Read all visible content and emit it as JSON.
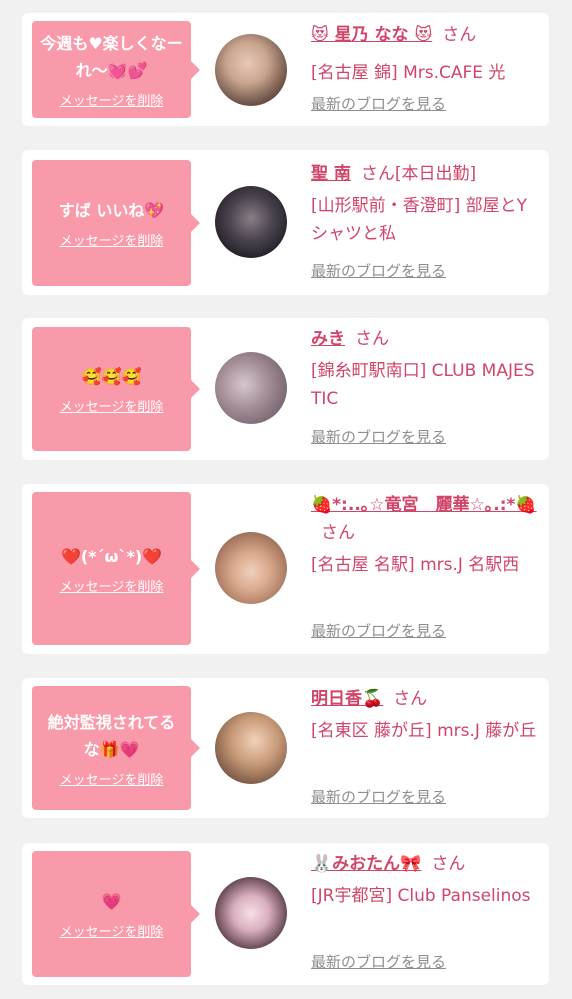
{
  "delete_label": "メッセージを削除",
  "blog_label": "最新のブログを見る",
  "san_label": "さん",
  "colors": {
    "background": "#f1f1f1",
    "bubble": "#f99aab",
    "accent": "#d04569",
    "link_gray": "#8e8e8e"
  },
  "items": [
    {
      "message": "今週も♥楽しくなーれ〜💓💕",
      "name": "😻 星乃 なな 😻",
      "name_suffix": "",
      "shop": "[名古屋 錦] Mrs.CAFE 光"
    },
    {
      "message": "すば いいね💖",
      "name": "聖 南",
      "name_suffix": "[本日出勤]",
      "shop": "[山形駅前・香澄町] 部屋とYシャツと私"
    },
    {
      "message": "🥰🥰🥰",
      "name": "みき",
      "name_suffix": "",
      "shop": "[錦糸町駅南口] CLUB MAJESTIC"
    },
    {
      "message": "❤️(*´ω`*)❤️",
      "name": "🍓*:..｡☆竜宮　麗華☆｡.:*🍓",
      "name_suffix": "",
      "shop": "[名古屋 名駅] mrs.J 名駅西"
    },
    {
      "message": "絶対監視されてるな🎁💗",
      "name": "明日香🍒",
      "name_suffix": "",
      "shop": "[名東区 藤が丘] mrs.J 藤が丘"
    },
    {
      "message": "💗",
      "name": "🐰みおたん🎀",
      "name_suffix": "",
      "shop": "[JR宇都宮] Club Panselinos"
    }
  ]
}
